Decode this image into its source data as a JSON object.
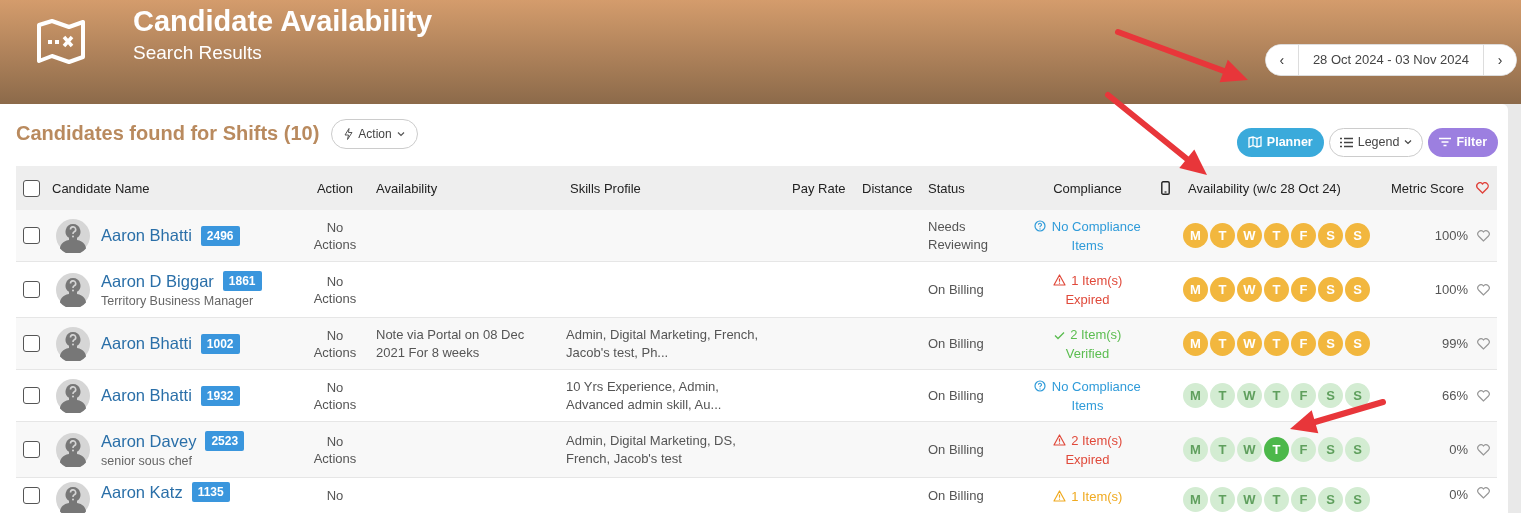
{
  "header": {
    "title": "Candidate Availability",
    "subtitle": "Search Results",
    "date_range": "28 Oct 2024 - 03 Nov 2024",
    "prev": "‹",
    "next": "›"
  },
  "results": {
    "title": "Candidates found for Shifts (10)",
    "action_button": "Action",
    "toolbar": [
      {
        "kind": "planner",
        "label": "Planner"
      },
      {
        "kind": "legend",
        "label": "Legend"
      },
      {
        "kind": "filter",
        "label": "Filter"
      }
    ]
  },
  "table": {
    "select_all_checked": false,
    "columns": [
      {
        "kind": "text",
        "label": "Candidate Name"
      },
      {
        "kind": "text",
        "label": "Action"
      },
      {
        "kind": "text",
        "label": "Availability"
      },
      {
        "kind": "text",
        "label": "Skills Profile"
      },
      {
        "kind": "text",
        "label": "Pay Rate"
      },
      {
        "kind": "text",
        "label": "Distance"
      },
      {
        "kind": "text",
        "label": "Status"
      },
      {
        "kind": "text",
        "label": "Compliance"
      },
      {
        "kind": "phone"
      },
      {
        "kind": "text",
        "label": "Availability (w/c 28 Oct 24)"
      },
      {
        "kind": "text",
        "label": "Metric Score"
      },
      {
        "kind": "heart"
      }
    ],
    "rows": [
      {
        "checked": false,
        "name": "Aaron Bhatti",
        "id": "2496",
        "action": "No Actions",
        "status": "Needs Reviewing",
        "compliance": {
          "kind": "info",
          "text": "No Compliance Items"
        },
        "days": [
          {
            "letter": "M",
            "color": "#f2b73e"
          },
          {
            "letter": "T",
            "color": "#f2b73e"
          },
          {
            "letter": "W",
            "color": "#f2b73e"
          },
          {
            "letter": "T",
            "color": "#f2b73e"
          },
          {
            "letter": "F",
            "color": "#f2b73e"
          },
          {
            "letter": "S",
            "color": "#f2b73e"
          },
          {
            "letter": "S",
            "color": "#f2b73e"
          }
        ],
        "metric": "100%",
        "favorite": false
      },
      {
        "checked": false,
        "name": "Aaron D Biggar",
        "id": "1861",
        "subtitle": "Territory Business Manager",
        "action": "No Actions",
        "status": "On Billing",
        "compliance": {
          "kind": "expired",
          "text": "1 Item(s) Expired"
        },
        "days": [
          {
            "letter": "M",
            "color": "#f2b73e"
          },
          {
            "letter": "T",
            "color": "#f2b73e"
          },
          {
            "letter": "W",
            "color": "#f2b73e"
          },
          {
            "letter": "T",
            "color": "#f2b73e"
          },
          {
            "letter": "F",
            "color": "#f2b73e"
          },
          {
            "letter": "S",
            "color": "#f2b73e"
          },
          {
            "letter": "S",
            "color": "#f2b73e"
          }
        ],
        "metric": "100%",
        "favorite": false
      },
      {
        "checked": false,
        "name": "Aaron Bhatti",
        "id": "1002",
        "action": "No Actions",
        "availability": "Note via Portal on 08 Dec 2021 For 8 weeks",
        "skills": "Admin, Digital Marketing, French, Jacob's test, Ph...",
        "status": "On Billing",
        "compliance": {
          "kind": "verified",
          "text": "2 Item(s) Verified"
        },
        "days": [
          {
            "letter": "M",
            "color": "#f2b73e"
          },
          {
            "letter": "T",
            "color": "#f2b73e"
          },
          {
            "letter": "W",
            "color": "#f2b73e"
          },
          {
            "letter": "T",
            "color": "#f2b73e"
          },
          {
            "letter": "F",
            "color": "#f2b73e"
          },
          {
            "letter": "S",
            "color": "#f2b73e"
          },
          {
            "letter": "S",
            "color": "#f2b73e"
          }
        ],
        "metric": "99%",
        "favorite": false
      },
      {
        "checked": false,
        "name": "Aaron Bhatti",
        "id": "1932",
        "action": "No Actions",
        "skills": "10 Yrs Experience, Admin, Advanced admin skill, Au...",
        "status": "On Billing",
        "compliance": {
          "kind": "info",
          "text": "No Compliance Items"
        },
        "days": [
          {
            "letter": "M",
            "color": "#d3ecd2"
          },
          {
            "letter": "T",
            "color": "#d3ecd2"
          },
          {
            "letter": "W",
            "color": "#d3ecd2"
          },
          {
            "letter": "T",
            "color": "#d3ecd2"
          },
          {
            "letter": "F",
            "color": "#d3ecd2"
          },
          {
            "letter": "S",
            "color": "#d3ecd2"
          },
          {
            "letter": "S",
            "color": "#d3ecd2"
          }
        ],
        "metric": "66%",
        "favorite": false
      },
      {
        "checked": false,
        "name": "Aaron Davey",
        "id": "2523",
        "subtitle": "senior sous chef",
        "action": "No Actions",
        "skills": "Admin, Digital Marketing, DS, French, Jacob's test",
        "status": "On Billing",
        "compliance": {
          "kind": "expired",
          "text": "2 Item(s) Expired"
        },
        "days": [
          {
            "letter": "M",
            "color": "#d3ecd2"
          },
          {
            "letter": "T",
            "color": "#d3ecd2"
          },
          {
            "letter": "W",
            "color": "#d3ecd2"
          },
          {
            "letter": "T",
            "color": "#4cb84a"
          },
          {
            "letter": "F",
            "color": "#d3ecd2"
          },
          {
            "letter": "S",
            "color": "#d3ecd2"
          },
          {
            "letter": "S",
            "color": "#d3ecd2"
          }
        ],
        "metric": "0%",
        "favorite": false
      },
      {
        "checked": false,
        "name": "Aaron Katz",
        "id": "1135",
        "action": "No",
        "status": "On Billing",
        "compliance": {
          "kind": "warning",
          "text": "1 Item(s)"
        },
        "days": [
          {
            "letter": "M",
            "color": "#d3ecd2"
          },
          {
            "letter": "T",
            "color": "#d3ecd2"
          },
          {
            "letter": "W",
            "color": "#d3ecd2"
          },
          {
            "letter": "T",
            "color": "#d3ecd2"
          },
          {
            "letter": "F",
            "color": "#d3ecd2"
          },
          {
            "letter": "S",
            "color": "#d3ecd2"
          },
          {
            "letter": "S",
            "color": "#d3ecd2"
          }
        ],
        "metric": "0%",
        "favorite": false
      }
    ]
  }
}
